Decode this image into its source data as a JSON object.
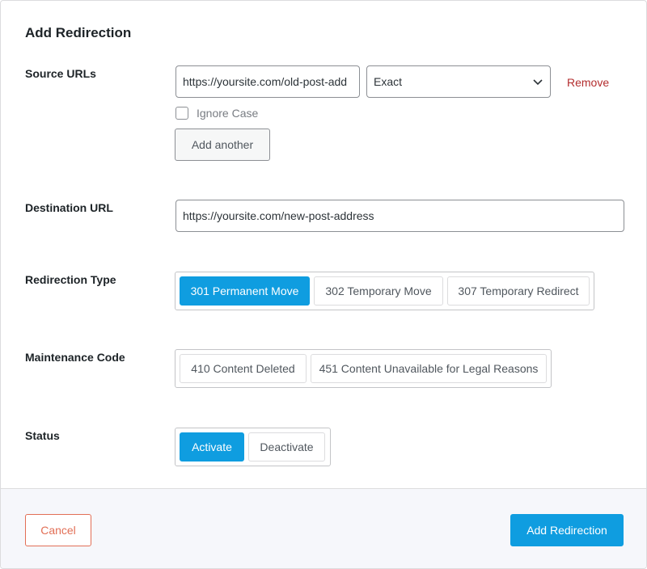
{
  "dialog": {
    "title": "Add Redirection"
  },
  "source": {
    "label": "Source URLs",
    "url_value": "https://yoursite.com/old-post-add",
    "match_type": "Exact",
    "remove_label": "Remove",
    "ignore_case_label": "Ignore Case",
    "ignore_case_checked": false,
    "add_another_label": "Add another"
  },
  "destination": {
    "label": "Destination URL",
    "url_value": "https://yoursite.com/new-post-address"
  },
  "redirection_type": {
    "label": "Redirection Type",
    "options": [
      "301 Permanent Move",
      "302 Temporary Move",
      "307 Temporary Redirect"
    ],
    "selected": "301 Permanent Move"
  },
  "maintenance_code": {
    "label": "Maintenance Code",
    "options": [
      "410 Content Deleted",
      "451 Content Unavailable for Legal Reasons"
    ],
    "selected": ""
  },
  "status": {
    "label": "Status",
    "options": [
      "Activate",
      "Deactivate"
    ],
    "selected": "Activate"
  },
  "footer": {
    "cancel_label": "Cancel",
    "submit_label": "Add Redirection"
  },
  "colors": {
    "accent": "#0f9de0",
    "danger": "#b32d2e",
    "cancel": "#e26f56"
  },
  "icons": {
    "select_arrow": "chevron-down-icon"
  }
}
